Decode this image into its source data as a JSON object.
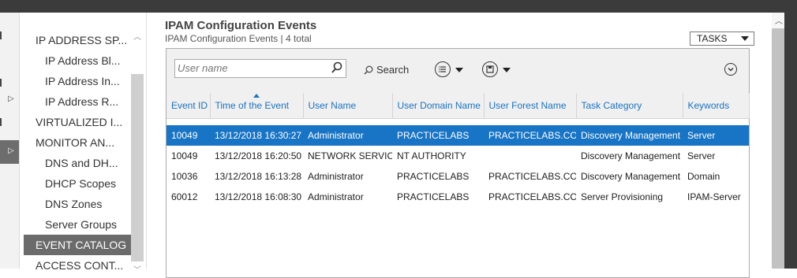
{
  "nav": {
    "items": [
      {
        "label": "IP ADDRESS SP...",
        "level": 1
      },
      {
        "label": "IP Address Bl...",
        "level": 2
      },
      {
        "label": "IP Address In...",
        "level": 2
      },
      {
        "label": "IP Address R...",
        "level": 2
      },
      {
        "label": "VIRTUALIZED I...",
        "level": 1
      },
      {
        "label": "MONITOR AN...",
        "level": 1
      },
      {
        "label": "DNS and DH...",
        "level": 2
      },
      {
        "label": "DHCP Scopes",
        "level": 2
      },
      {
        "label": "DNS Zones",
        "level": 2
      },
      {
        "label": "Server Groups",
        "level": 2
      },
      {
        "label": "EVENT CATALOG",
        "level": 1,
        "active": true
      },
      {
        "label": "ACCESS CONT...",
        "level": 1
      }
    ]
  },
  "header": {
    "title": "IPAM Configuration Events",
    "subtitle": "IPAM Configuration Events | 4 total",
    "tasks_label": "TASKS"
  },
  "toolbar": {
    "search_placeholder": "User name",
    "search_label": "Search",
    "icons": [
      "list-view-icon",
      "save-icon",
      "expand-icon"
    ]
  },
  "table": {
    "columns": [
      "Event ID",
      "Time of the Event",
      "User Name",
      "User Domain Name",
      "User Forest Name",
      "Task Category",
      "Keywords"
    ],
    "rows": [
      [
        "10049",
        "13/12/2018 16:30:27",
        "Administrator",
        "PRACTICELABS",
        "PRACTICELABS.COM",
        "Discovery Management",
        "Server"
      ],
      [
        "10049",
        "13/12/2018 16:20:50",
        "NETWORK SERVICE",
        "NT AUTHORITY",
        "",
        "Discovery Management",
        "Server"
      ],
      [
        "10036",
        "13/12/2018 16:13:28",
        "Administrator",
        "PRACTICELABS",
        "PRACTICELABS.COM",
        "Discovery Management",
        "Domain"
      ],
      [
        "60012",
        "13/12/2018 16:08:30",
        "Administrator",
        "PRACTICELABS",
        "PRACTICELABS.COM",
        "Server Provisioning",
        "IPAM-Server"
      ]
    ]
  },
  "colors": {
    "selected_row": "#1874c4",
    "header_text": "#1a73c1",
    "active_nav": "#6b6b6b"
  }
}
